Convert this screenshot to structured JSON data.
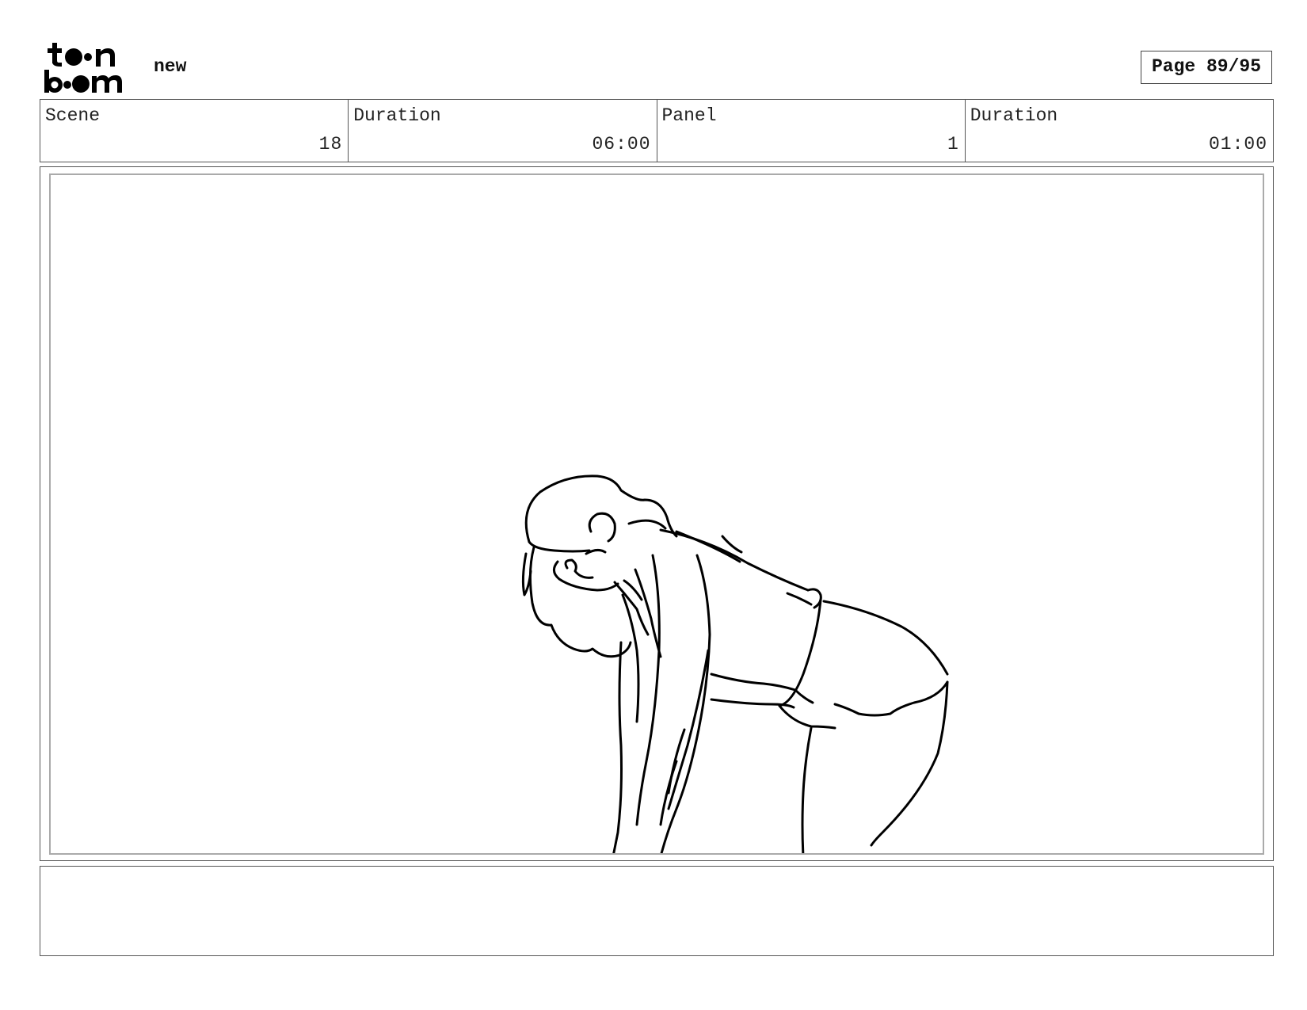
{
  "header": {
    "project_name": "new",
    "page_label": "Page 89/95"
  },
  "info": [
    {
      "label": "Scene",
      "value": "18"
    },
    {
      "label": "Duration",
      "value": "06:00"
    },
    {
      "label": "Panel",
      "value": "1"
    },
    {
      "label": "Duration",
      "value": "01:00"
    }
  ],
  "notes": {
    "text": ""
  }
}
